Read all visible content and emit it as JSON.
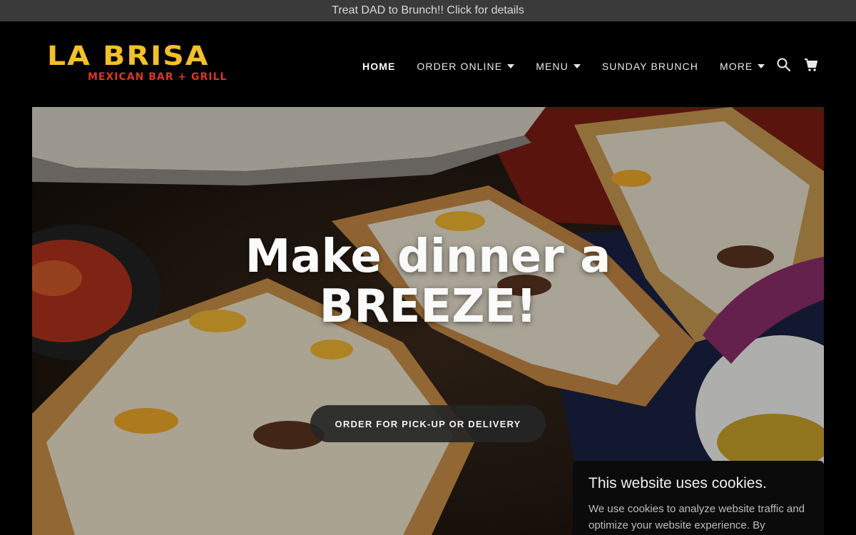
{
  "announcement": {
    "text": "Treat DAD to Brunch!! Click for details"
  },
  "brand": {
    "name": "LA BRISA",
    "tagline": "MEXICAN BAR + GRILL"
  },
  "nav": {
    "items": [
      {
        "label": "HOME",
        "has_dropdown": false,
        "active": true
      },
      {
        "label": "ORDER ONLINE",
        "has_dropdown": true
      },
      {
        "label": "MENU",
        "has_dropdown": true
      },
      {
        "label": "SUNDAY BRUNCH",
        "has_dropdown": false
      },
      {
        "label": "MORE",
        "has_dropdown": true
      }
    ],
    "icons": [
      "search-icon",
      "cart-icon"
    ]
  },
  "hero": {
    "title_line1": "Make dinner a",
    "title_line2": "BREEZE!",
    "cta_label": "ORDER FOR PICK-UP OR DELIVERY"
  },
  "cookie_banner": {
    "title": "This website uses cookies.",
    "text": "We use cookies to analyze website traffic and optimize your website experience. By accepting"
  },
  "colors": {
    "brand_yellow": "#f3c02a",
    "brand_red": "#d63a2a",
    "announcement_bg": "#3a3a3a",
    "header_bg": "#000000"
  }
}
